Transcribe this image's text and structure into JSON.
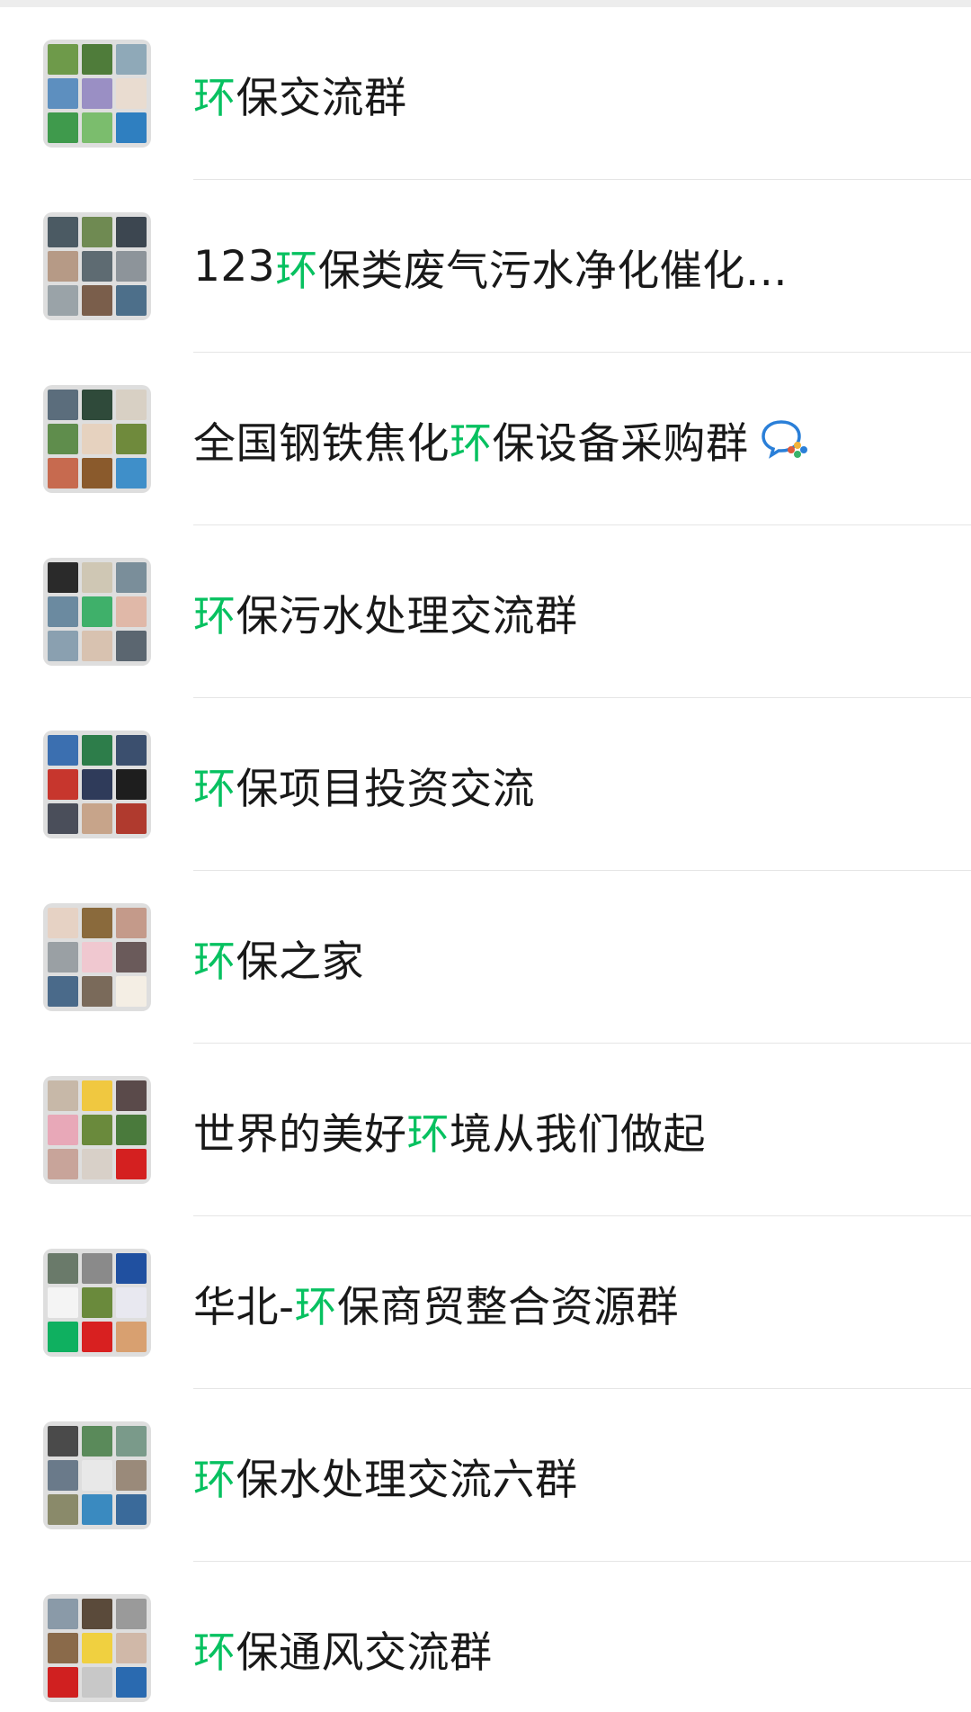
{
  "groups": [
    {
      "name_parts": [
        "",
        "环",
        "保交流群"
      ],
      "tiles": [
        "#6e9a4a",
        "#4f7c3a",
        "#8fa9b8",
        "#5d8fbf",
        "#9a8fc4",
        "#e9dcd0",
        "#3f9a4c",
        "#7bbd6d",
        "#2f7fc0"
      ]
    },
    {
      "name_parts": [
        "123",
        "环",
        "保类废气污水净化催化…"
      ],
      "tiles": [
        "#4b5a63",
        "#6f8a52",
        "#3c4650",
        "#b69a86",
        "#5e6b72",
        "#8d949a",
        "#9aa3a8",
        "#7a5e4b",
        "#4d6f8a"
      ]
    },
    {
      "name_parts": [
        "全国钢铁焦化",
        "环",
        "保设备采购群"
      ],
      "tiles": [
        "#5b6d7c",
        "#2f4a3a",
        "#d8d0c4",
        "#5f8d4c",
        "#e6d2bf",
        "#6f8a3c",
        "#c76a4f",
        "#8a5a2c",
        "#3f8fc9"
      ],
      "has_wecom_badge": true,
      "badge_icon": "wecom-chat-icon"
    },
    {
      "name_parts": [
        "",
        "环",
        "保污水处理交流群"
      ],
      "tiles": [
        "#2a2a2a",
        "#cfc7b4",
        "#7a8e9a",
        "#6b8aa0",
        "#3fb06a",
        "#e0b8a8",
        "#8aa0b0",
        "#d8c2b0",
        "#5b6670"
      ]
    },
    {
      "name_parts": [
        "",
        "环",
        "保项目投资交流"
      ],
      "tiles": [
        "#3b6fb0",
        "#2d7d4a",
        "#3b4f6e",
        "#c7362d",
        "#2f3b5a",
        "#1e1e1e",
        "#4a4e5a",
        "#c7a48a",
        "#b03a2e"
      ]
    },
    {
      "name_parts": [
        "",
        "环",
        "保之家"
      ],
      "tiles": [
        "#e6d2c4",
        "#8a6a3c",
        "#c49a8a",
        "#9aa0a4",
        "#f0c8d0",
        "#6a5a5a",
        "#4a6a8a",
        "#7a6a5a",
        "#f4eee4"
      ]
    },
    {
      "name_parts": [
        "世界的美好",
        "环",
        "境从我们做起"
      ],
      "tiles": [
        "#c7b8a8",
        "#f0c840",
        "#5a4a4a",
        "#e8a8b8",
        "#6a8a3c",
        "#4a7a3c",
        "#c8a49a",
        "#d8d0c8",
        "#d42020"
      ]
    },
    {
      "name_parts": [
        "华北-",
        "环",
        "保商贸整合资源群"
      ],
      "tiles": [
        "#6a7a6a",
        "#8a8a8a",
        "#2050a0",
        "#f4f4f4",
        "#6a8a3c",
        "#e8e8f0",
        "#0fb060",
        "#d82020",
        "#d8a070"
      ]
    },
    {
      "name_parts": [
        "",
        "环",
        "保水处理交流六群"
      ],
      "tiles": [
        "#4a4a4a",
        "#5a8a5a",
        "#7a9a8a",
        "#6a7a8a",
        "#e8e8e8",
        "#9a8a7a",
        "#8a8a6a",
        "#3a8ac0",
        "#3a6a9a"
      ]
    },
    {
      "name_parts": [
        "",
        "环",
        "保通风交流群"
      ],
      "tiles": [
        "#8a9aa8",
        "#5a4a3a",
        "#9a9a9a",
        "#8a6a4a",
        "#f0d040",
        "#d0b8a8",
        "#d02020",
        "#c8c8c8",
        "#2a6ab0"
      ]
    }
  ],
  "colors": {
    "highlight": "#07c160",
    "text": "#191919",
    "divider": "#e5e5e5"
  }
}
